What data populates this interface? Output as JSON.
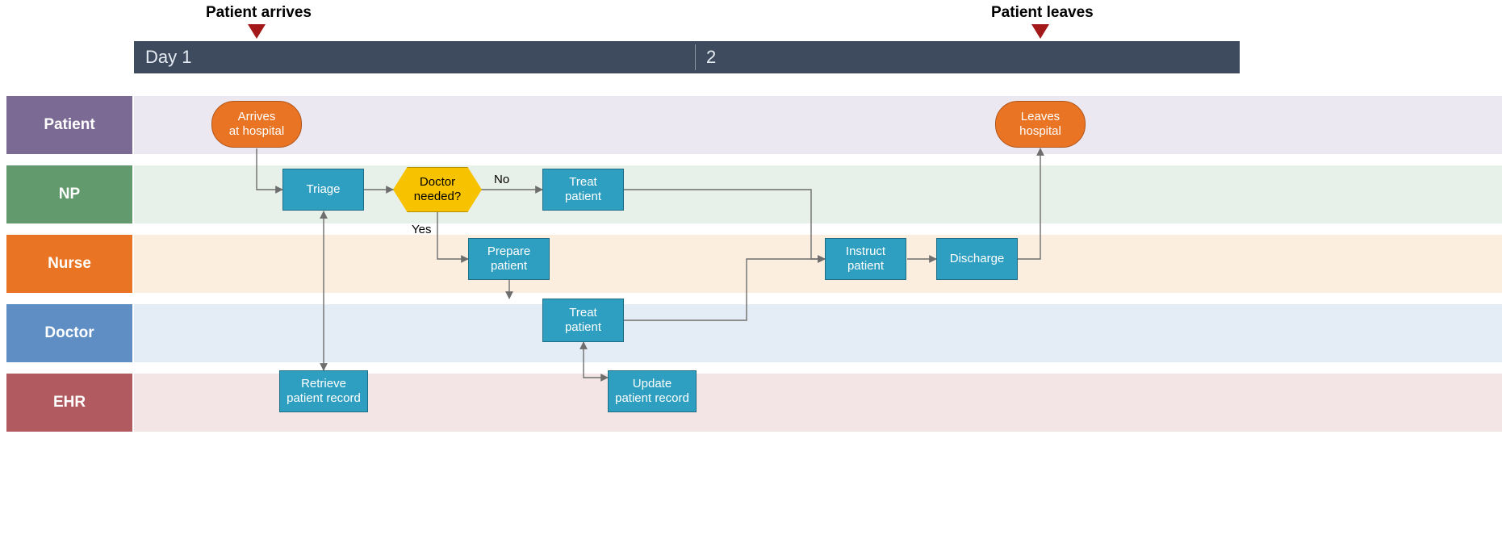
{
  "milestones": {
    "start": "Patient arrives",
    "end": "Patient leaves"
  },
  "timeline": {
    "seg1": "Day 1",
    "seg2": "2"
  },
  "lanes": {
    "patient": "Patient",
    "np": "NP",
    "nurse": "Nurse",
    "doctor": "Doctor",
    "ehr": "EHR"
  },
  "nodes": {
    "arrives": "Arrives\nat hospital",
    "triage": "Triage",
    "decision": "Doctor\nneeded?",
    "np_treat": "Treat\npatient",
    "prepare": "Prepare\npatient",
    "doc_treat": "Treat\npatient",
    "retrieve": "Retrieve\npatient record",
    "update": "Update\npatient record",
    "instruct": "Instruct\npatient",
    "discharge": "Discharge",
    "leaves": "Leaves\nhospital"
  },
  "edges": {
    "no": "No",
    "yes": "Yes"
  },
  "colors": {
    "patient": "#7b6a93",
    "patient_strip": "#ece8f1",
    "np": "#639a6d",
    "np_strip": "#e7f0e9",
    "nurse": "#e87424",
    "nurse_strip": "#fbeedf",
    "doctor": "#5f8ec4",
    "doctor_strip": "#e4edf6",
    "ehr": "#b15a5f",
    "ehr_strip": "#f3e5e6"
  }
}
